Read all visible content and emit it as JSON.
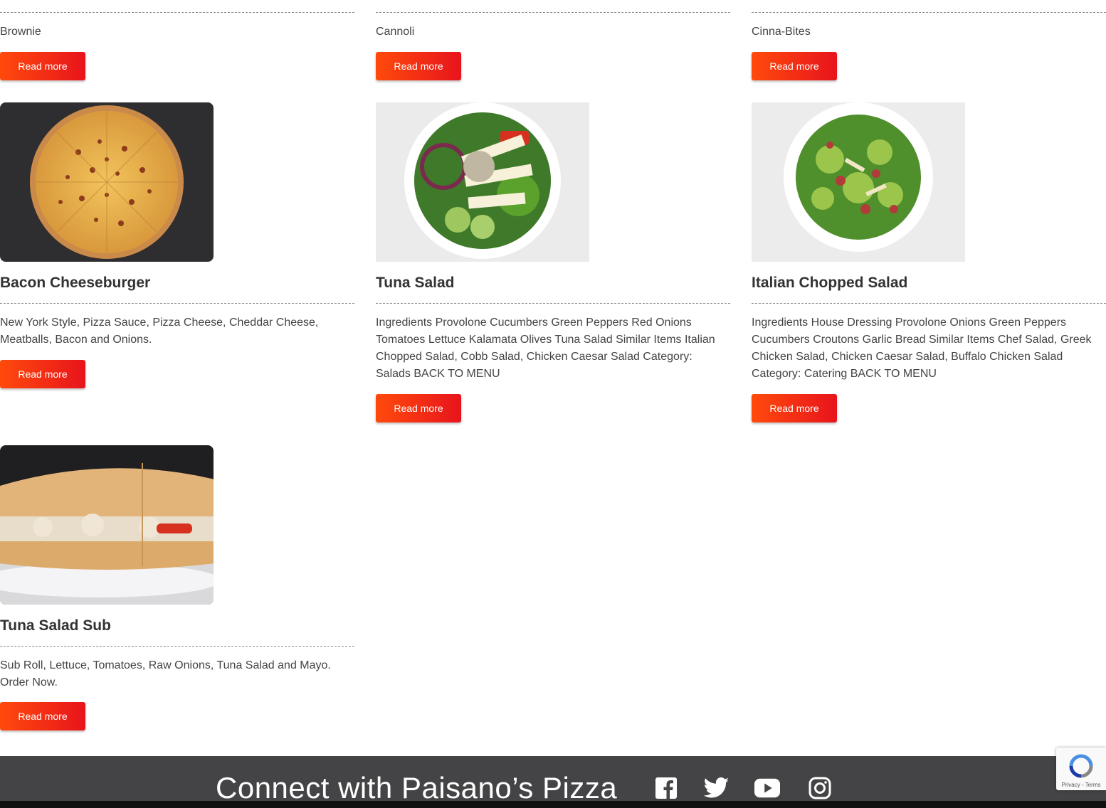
{
  "top_row": [
    {
      "name": "Brownie",
      "button": "Read more"
    },
    {
      "name": "Cannoli",
      "button": "Read more"
    },
    {
      "name": "Cinna-Bites",
      "button": "Read more"
    }
  ],
  "products": [
    {
      "title": "Bacon Cheeseburger",
      "description": "New York Style, Pizza Sauce, Pizza Cheese, Cheddar Cheese, Meatballs, Bacon and Onions.",
      "button": "Read more"
    },
    {
      "title": "Tuna Salad",
      "description": "Ingredients Provolone Cucumbers Green Peppers Red Onions Tomatoes Lettuce Kalamata Olives Tuna Salad Similar Items Italian Chopped Salad, Cobb Salad, Chicken Caesar Salad Category: Salads BACK TO MENU",
      "button": "Read more"
    },
    {
      "title": "Italian Chopped Salad",
      "description": "Ingredients House Dressing Provolone  Onions Green Peppers Cucumbers Croutons Garlic Bread Similar Items Chef Salad, Greek Chicken Salad, Chicken Caesar Salad, Buffalo Chicken Salad Category: Catering BACK TO MENU",
      "button": "Read more"
    },
    {
      "title": "Tuna Salad Sub",
      "description": "Sub Roll, Lettuce, Tomatoes, Raw Onions, Tuna Salad and Mayo. Order Now.",
      "button": "Read more"
    }
  ],
  "footer": {
    "title": "Connect with Paisano’s Pizza",
    "social": [
      "facebook-icon",
      "twitter-icon",
      "youtube-icon",
      "instagram-icon"
    ]
  },
  "recaptcha": {
    "links": "Privacy - Terms"
  },
  "colors": {
    "button_start": "#ff4a0c",
    "button_end": "#e8141c",
    "footer_bg": "#444446"
  }
}
